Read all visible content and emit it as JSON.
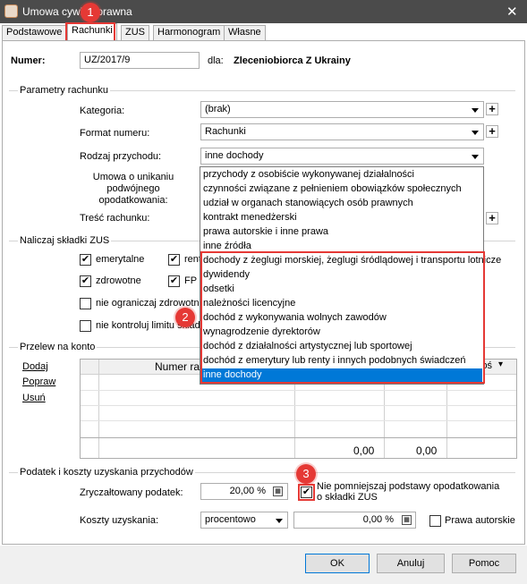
{
  "window": {
    "title": "Umowa cywilnoprawna",
    "close": "✕"
  },
  "tabs": [
    "Podstawowe",
    "Rachunki",
    "ZUS",
    "Harmonogram",
    "Własne"
  ],
  "header": {
    "numer_label": "Numer:",
    "numer_value": "UZ/2017/9",
    "dla_label": "dla:",
    "dla_value": "Zleceniobiorca Z Ukrainy"
  },
  "rachunek": {
    "group": "Parametry rachunku",
    "kategoria_label": "Kategoria:",
    "kategoria_value": "(brak)",
    "format_label": "Format numeru:",
    "format_value": "Rachunki",
    "rodzaj_label": "Rodzaj przychodu:",
    "rodzaj_value": "inne dochody",
    "umowa_label": "Umowa o unikaniu podwójnego opodatkowania:",
    "tresc_label": "Treść rachunku:"
  },
  "dropdown_items": [
    "przychody z osobiście wykonywanej działalności",
    "czynności związane z pełnieniem obowiązków społecznych",
    "udział w organach stanowiących osób prawnych",
    "kontrakt menedżerski",
    "prawa autorskie i inne prawa",
    "inne źródła",
    "dochody z żeglugi morskiej, żeglugi śródlądowej i transportu lotnicze",
    "dywidendy",
    "odsetki",
    "należności licencyjne",
    "dochód z wykonywania wolnych zawodów",
    "wynagrodzenie dyrektorów",
    "dochód z działalności artystycznej lub sportowej",
    "dochód z emerytury lub renty i innych podobnych świadczeń",
    "inne dochody"
  ],
  "dropdown_selected_index": 14,
  "zus": {
    "group": "Naliczaj składki ZUS",
    "emerytalne": "emerytalne",
    "renty": "rent",
    "zdrowotne": "zdrowotne",
    "fp": "FP",
    "nie_ograniczaj": "nie ograniczaj zdrowotn",
    "nie_kontroluj": "nie kontroluj limitu skład"
  },
  "przelew": {
    "group": "Przelew na konto",
    "dodaj": "Dodaj",
    "popraw": "Popraw",
    "usun": "Usuń",
    "col_numer": "Numer ra",
    "col_last": "łoś",
    "sum1": "0,00",
    "sum2": "0,00"
  },
  "podatek": {
    "group": "Podatek i koszty uzyskania przychodów",
    "zryczaltowany_label": "Zryczałtowany podatek:",
    "zryczaltowany_value": "20,00 %",
    "nie_pomniejszaj": "Nie pomniejszaj podstawy opodatkowania o składki ZUS",
    "koszty_label": "Koszty uzyskania:",
    "koszty_type": "procentowo",
    "koszty_value": "0,00 %",
    "prawa_autorskie": "Prawa autorskie"
  },
  "buttons": {
    "ok": "OK",
    "anuluj": "Anuluj",
    "pomoc": "Pomoc"
  },
  "badges": [
    "1",
    "2",
    "3"
  ],
  "colors": {
    "titlebar": "#4b4b4b",
    "selection": "#0078d7",
    "annotation": "#e53935"
  }
}
